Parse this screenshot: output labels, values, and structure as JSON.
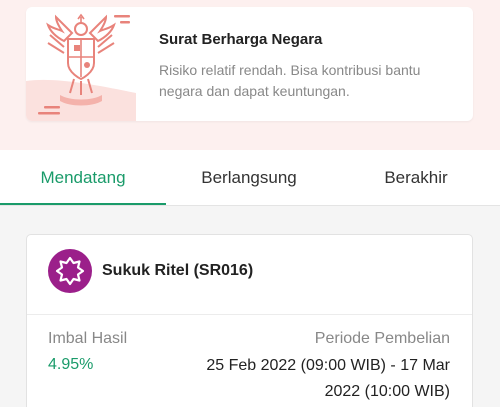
{
  "info": {
    "title": "Surat Berharga Negara",
    "description": "Risiko relatif rendah. Bisa kontribusi bantu negara dan dapat keuntungan.",
    "emblem_icon": "garuda-emblem-icon"
  },
  "tabs": [
    {
      "label": "Mendatang",
      "active": true
    },
    {
      "label": "Berlangsung",
      "active": false
    },
    {
      "label": "Berakhir",
      "active": false
    }
  ],
  "product": {
    "name": "Sukuk Ritel (SR016)",
    "logo_icon": "star-badge-icon",
    "yield_label": "Imbal Hasil",
    "yield_value": "4.95%",
    "period_label": "Periode Pembelian",
    "period_value": "25 Feb 2022 (09:00 WIB) - 17 Mar 2022 (10:00 WIB)"
  },
  "colors": {
    "accent": "#1a9b6a",
    "emblem": "#e8837b",
    "logo_bg": "#9b1f8a",
    "banner_bg": "#fdf0ef"
  }
}
